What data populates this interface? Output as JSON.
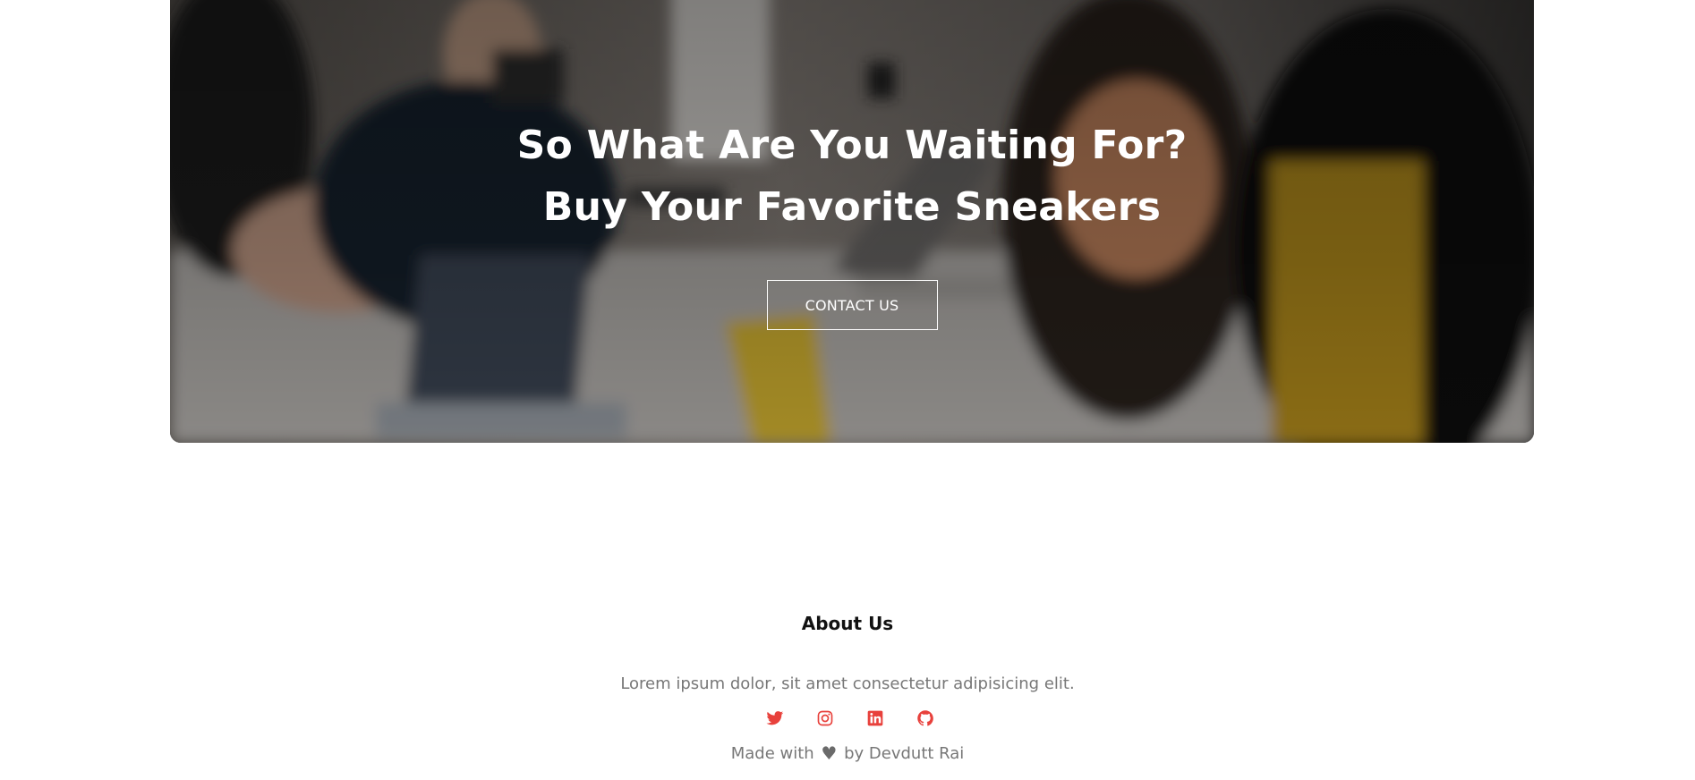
{
  "cta": {
    "heading_line1": "So What Are You Waiting For?",
    "heading_line2": "Buy Your Favorite Sneakers",
    "button_label": "CONTACT US"
  },
  "footer": {
    "title": "About Us",
    "description": "Lorem ipsum dolor, sit amet consectetur adipisicing elit.",
    "social": [
      {
        "icon": "twitter-icon"
      },
      {
        "icon": "instagram-icon"
      },
      {
        "icon": "linkedin-icon"
      },
      {
        "icon": "github-icon"
      }
    ],
    "made_with_prefix": "Made with",
    "heart_glyph": "♥",
    "made_with_suffix": "by Devdutt Rai"
  },
  "colors": {
    "accent": "#e8413c",
    "muted_text": "#777777",
    "heading_text": "#111111"
  }
}
